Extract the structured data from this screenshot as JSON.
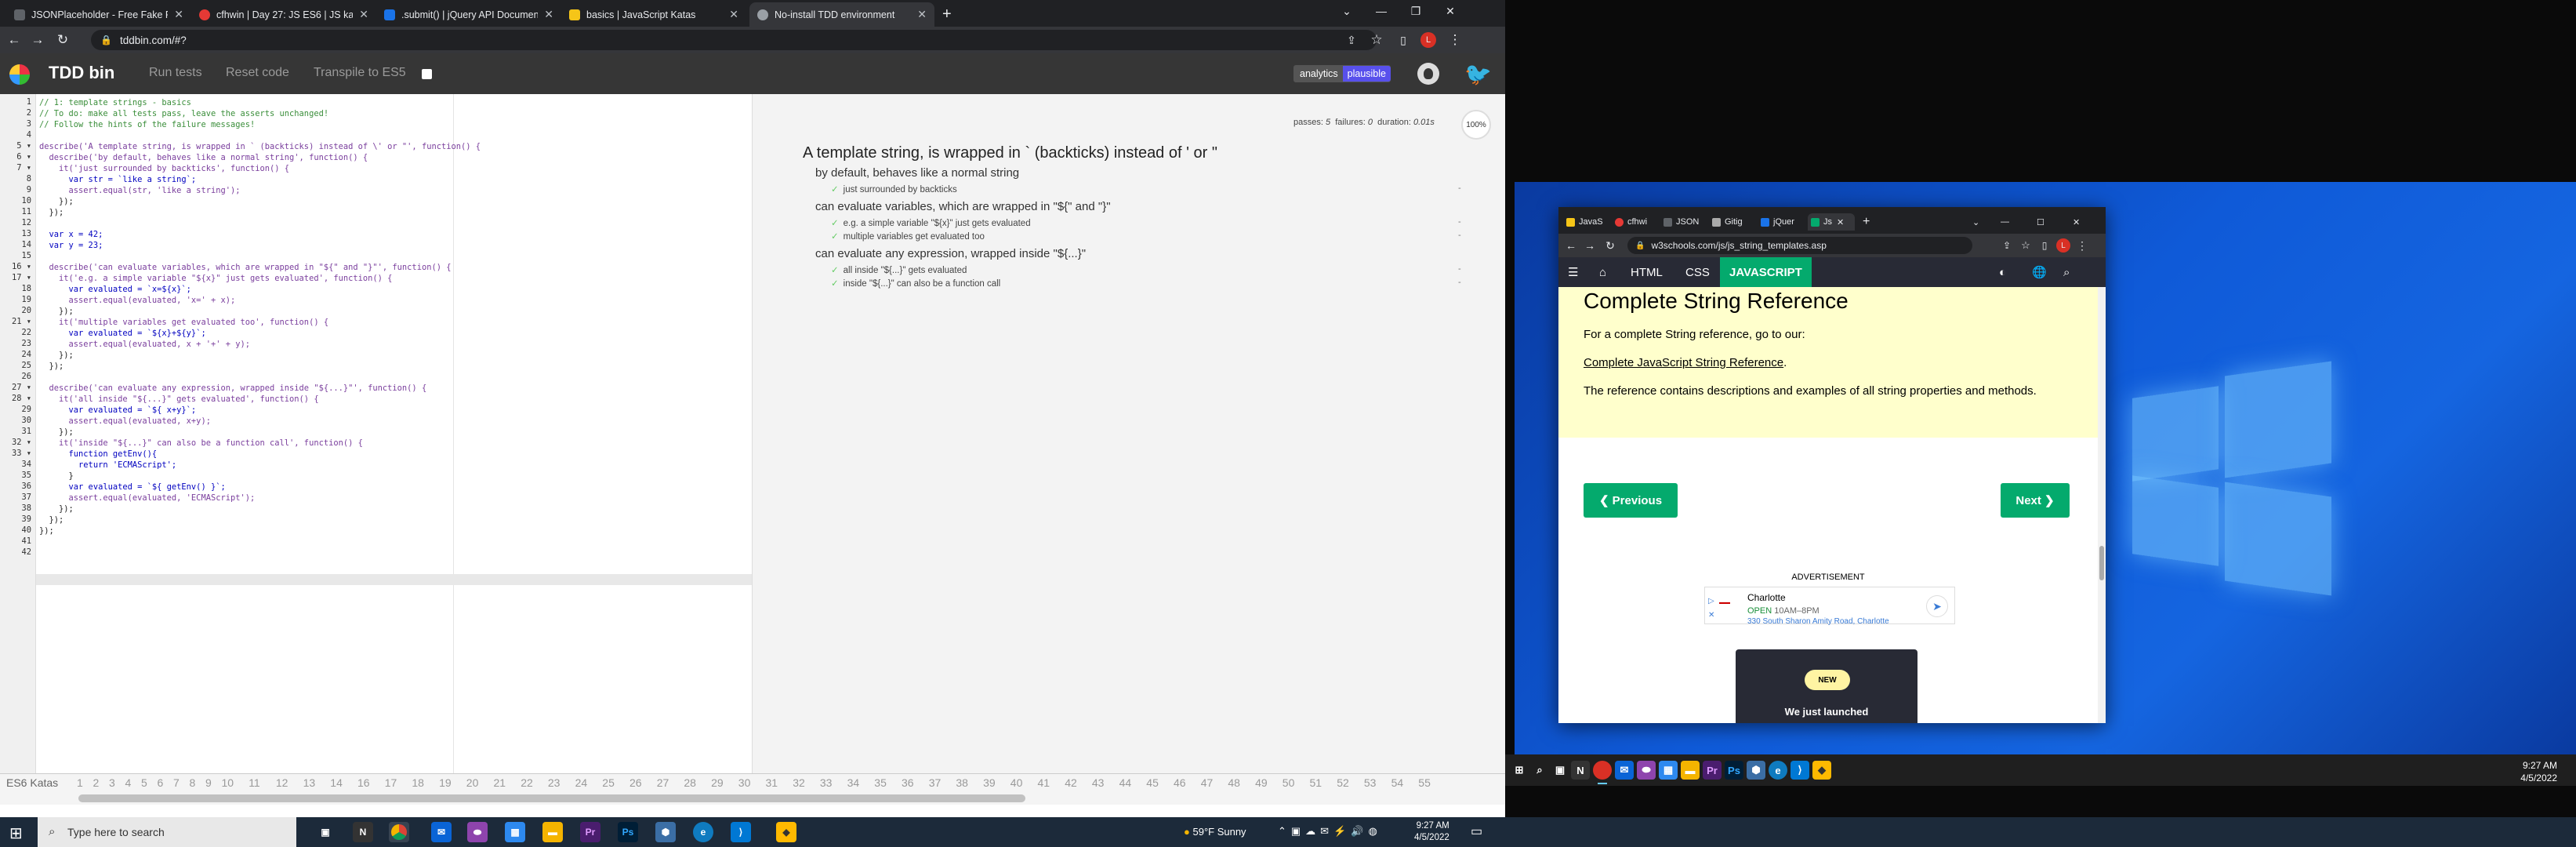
{
  "tabs": [
    {
      "title": "JSONPlaceholder - Free Fake RES",
      "color": "#5f6368"
    },
    {
      "title": "cfhwin | Day 27: JS ES6 | JS katas",
      "color": "#e53935"
    },
    {
      "title": ".submit() | jQuery API Documenta",
      "color": "#1a73e8"
    },
    {
      "title": "basics | JavaScript Katas",
      "color": "#f5c518"
    },
    {
      "title": "No-install TDD environment",
      "color": "#9aa0a6"
    }
  ],
  "address": "tddbin.com/#?",
  "app": {
    "title": "TDD bin",
    "run_tests": "Run tests",
    "reset_code": "Reset code",
    "transpile": "Transpile to ES5",
    "analytics": "analytics",
    "analytics_brand": "plausible"
  },
  "editor": {
    "lines": [
      "// 1: template strings - basics",
      "// To do: make all tests pass, leave the asserts unchanged!",
      "// Follow the hints of the failure messages!",
      "",
      "describe('A template string, is wrapped in ` (backticks) instead of \\' or \"', function() {",
      "  describe('by default, behaves like a normal string', function() {",
      "    it('just surrounded by backticks', function() {",
      "      var str = `like a string`;",
      "      assert.equal(str, 'like a string');",
      "    });",
      "  });",
      "",
      "  var x = 42;",
      "  var y = 23;",
      "",
      "  describe('can evaluate variables, which are wrapped in \"${\" and \"}\"', function() {",
      "    it('e.g. a simple variable \"${x}\" just gets evaluated', function() {",
      "      var evaluated = `x=${x}`;",
      "      assert.equal(evaluated, 'x=' + x);",
      "    });",
      "    it('multiple variables get evaluated too', function() {",
      "      var evaluated = `${x}+${y}`;",
      "      assert.equal(evaluated, x + '+' + y);",
      "    });",
      "  });",
      "",
      "  describe('can evaluate any expression, wrapped inside \"${...}\"', function() {",
      "    it('all inside \"${...}\" gets evaluated', function() {",
      "      var evaluated = `${ x+y}`;",
      "      assert.equal(evaluated, x+y);",
      "    });",
      "    it('inside \"${...}\" can also be a function call', function() {",
      "      function getEnv(){",
      "        return 'ECMAScript';",
      "      }",
      "      var evaluated = `${ getEnv() }`;",
      "      assert.equal(evaluated, 'ECMAScript');",
      "    });",
      "  });",
      "});",
      "",
      ""
    ]
  },
  "results": {
    "passes_label": "passes:",
    "passes": "5",
    "failures_label": "failures:",
    "failures": "0",
    "duration_label": "duration:",
    "duration": "0.01s",
    "percent": "100%",
    "title": "A template string, is wrapped in ` (backticks) instead of ' or \"",
    "groups": [
      {
        "desc": "by default, behaves like a normal string",
        "its": [
          "just surrounded by backticks"
        ]
      },
      {
        "desc": "can evaluate variables, which are wrapped in \"${\" and \"}\"",
        "its": [
          "e.g. a simple variable \"${x}\" just gets evaluated",
          "multiple variables get evaluated too"
        ]
      },
      {
        "desc": "can evaluate any expression, wrapped inside \"${...}\"",
        "its": [
          "all inside \"${...}\" gets evaluated",
          "inside \"${...}\" can also be a function call"
        ]
      }
    ]
  },
  "katas": {
    "label": "ES6 Katas",
    "numbers": [
      "1",
      "2",
      "3",
      "4",
      "5",
      "6",
      "7",
      "8",
      "9",
      "10",
      "11",
      "12",
      "13",
      "14",
      "16",
      "17",
      "18",
      "19",
      "20",
      "21",
      "22",
      "23",
      "24",
      "25",
      "26",
      "27",
      "28",
      "29",
      "30",
      "31",
      "32",
      "33",
      "34",
      "35",
      "36",
      "37",
      "38",
      "39",
      "40",
      "41",
      "42",
      "43",
      "44",
      "45",
      "46",
      "47",
      "48",
      "49",
      "50",
      "51",
      "52",
      "53",
      "54",
      "55"
    ]
  },
  "w3": {
    "tabs": [
      "JavaS",
      "cfhwi",
      "JSON",
      "Gitig",
      "jQuer",
      "Js"
    ],
    "address": "w3schools.com/js/js_string_templates.asp",
    "nav": [
      "HTML",
      "CSS",
      "JAVASCRIPT"
    ],
    "heading": "Complete String Reference",
    "p1": "For a complete String reference, go to our:",
    "link": "Complete JavaScript String Reference",
    "p2": "The reference contains descriptions and examples of all string properties and methods.",
    "prev": "❮ Previous",
    "next": "Next ❯",
    "ad_label": "ADVERTISEMENT",
    "ad_name": "Charlotte",
    "ad_open": "OPEN",
    "ad_hours": "10AM–8PM",
    "ad_address": "330 South Sharon Amity Road, Charlotte",
    "new_badge": "NEW",
    "new_text": "We just launched"
  },
  "right_clock": {
    "time": "9:27 AM",
    "date": "4/5/2022"
  },
  "taskbar": {
    "search": "Type here to search",
    "weather": "59°F  Sunny",
    "time": "9:27 AM",
    "date": "4/5/2022"
  }
}
